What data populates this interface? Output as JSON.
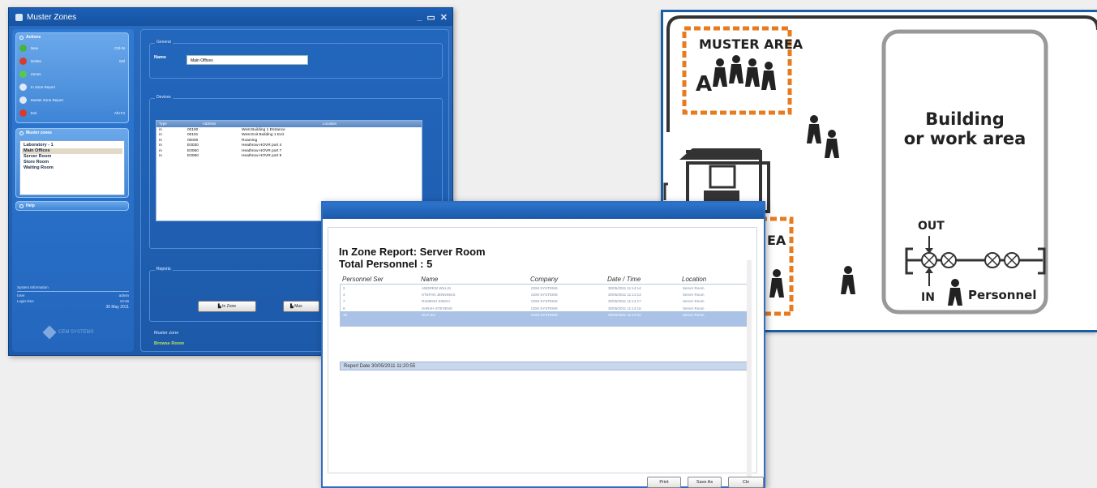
{
  "main_window": {
    "title": "Muster Zones",
    "actions_header": "Actions",
    "actions": [
      {
        "label": "New",
        "shortcut": "Ctrl+N",
        "color": "#46b53b"
      },
      {
        "label": "Delete",
        "shortcut": "Del",
        "color": "#d83a2e"
      },
      {
        "label": "Zones",
        "shortcut": "",
        "color": "#5cc84a"
      },
      {
        "label": "In Zone Report",
        "shortcut": "",
        "color": "#dfe8f4"
      },
      {
        "label": "Muster Zone Report",
        "shortcut": "",
        "color": "#dfe8f4"
      },
      {
        "label": "Exit",
        "shortcut": "Alt+F4",
        "color": "#d83a2e"
      }
    ],
    "zones_header": "Muster zones",
    "zones": [
      "Laboratory - 1",
      "Main Offices",
      "Server Room",
      "Store Room",
      "Waiting Room"
    ],
    "help_header": "Help",
    "system_info": {
      "label": "System Information",
      "user_label": "User",
      "user_value": "admin",
      "login_label": "Login time",
      "login_value": "10:46",
      "date": "30 May 2011"
    },
    "logo_text": "CEM SYSTEMS",
    "general_label": "General",
    "name_label": "Name",
    "name_value": "Main Offices",
    "devices_label": "Devices",
    "device_columns": {
      "type": "Type",
      "address": "Address",
      "location": "Location"
    },
    "devices": [
      {
        "type": "in",
        "address": "00190",
        "location": "West Building 1 Entrance"
      },
      {
        "type": "in",
        "address": "00191",
        "location": "West Exit Building 1 Exit"
      },
      {
        "type": "in",
        "address": "00000",
        "location": "Roaming"
      },
      {
        "type": "in",
        "address": "E0030",
        "location": "Heathrow HOVR port 4"
      },
      {
        "type": "in",
        "address": "E0060",
        "location": "Heathrow HOVR port 7"
      },
      {
        "type": "in",
        "address": "E0080",
        "location": "Heathrow HOVR port 9"
      }
    ],
    "reports_label": "Reports",
    "in_zone_button": "In Zone",
    "muster_button": "Mus",
    "muster_zone_label": "Muster zone",
    "muster_zone_value": "Browse Room"
  },
  "diagram": {
    "muster_area_top": "MUSTER AREA",
    "muster_letter": "A",
    "muster_area_bottom_fragment": "EA",
    "building_line1": "Building",
    "building_line2": "or work area",
    "out_label": "OUT",
    "in_label": "IN",
    "personnel_label": "Personnel",
    "accent_color": "#e87b1e",
    "frame_color": "#1b5ea8"
  },
  "report": {
    "title": "In Zone Report: Server Room",
    "total": "Total Personnel : 5",
    "columns": [
      "Personnel Ser",
      "Name",
      "Company",
      "Date / Time",
      "Location"
    ],
    "rows": [
      [
        "2",
        "ANDREW WILLIS",
        "CEM SYSTEMS",
        "30/05/2011 11:14:14",
        "Server Room"
      ],
      [
        "4",
        "STEFAN JENNINGS",
        "CEM SYSTEMS",
        "30/05/2011 11:14:13",
        "Server Room"
      ],
      [
        "7",
        "RAMESH SINGH",
        "CEM SYSTEMS",
        "30/05/2011 11:14:17",
        "Server Room"
      ],
      [
        "8",
        "SARAH STEVENS",
        "CEM SYSTEMS",
        "30/05/2011 11:14:15",
        "Server Room"
      ],
      [
        "10",
        "HUA SU",
        "CEM SYSTEMS",
        "30/05/2011 11:14:10",
        "Server Room"
      ]
    ],
    "report_date": "Report Date 30/05/2011 11:20:55",
    "print_button": "Print",
    "save_button": "Save As",
    "close_button": "Clo"
  }
}
